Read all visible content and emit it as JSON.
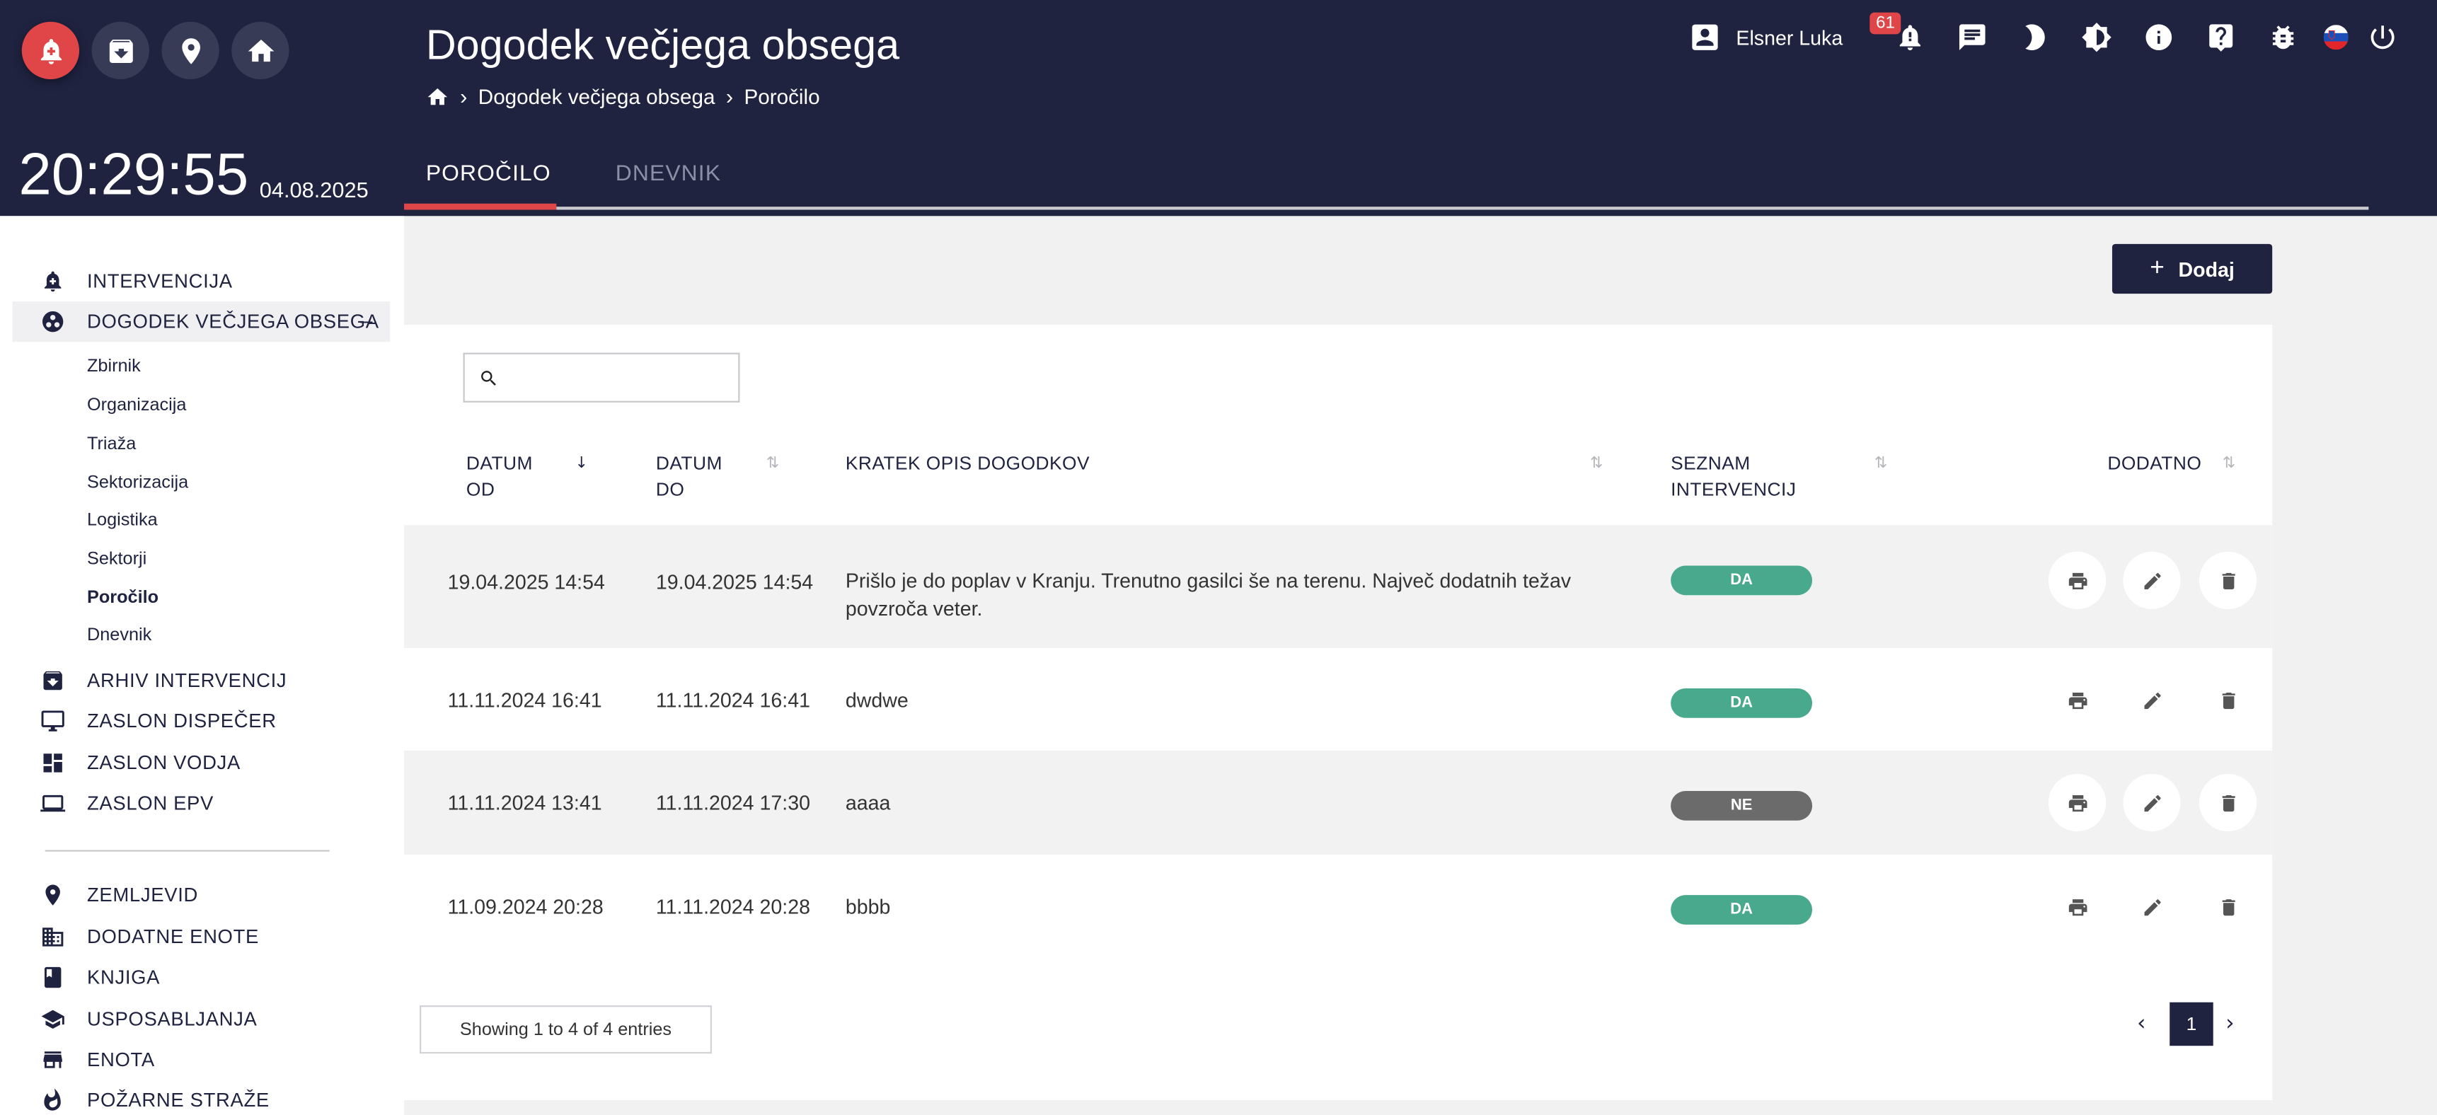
{
  "header": {
    "title": "Dogodek večjega obsega",
    "breadcrumb": [
      "Dogodek večjega obsega",
      "Poročilo"
    ],
    "time": "20:29:55",
    "date": "04.08.2025",
    "user_name": "Elsner Luka",
    "notification_count": "61",
    "tabs": [
      {
        "label": "POROČILO",
        "active": true
      },
      {
        "label": "DNEVNIK",
        "active": false
      }
    ],
    "icons": [
      "alarm-add-icon",
      "archive-icon",
      "location-pin-icon",
      "home-icon",
      "account-box-icon",
      "bell-icon",
      "chat-icon",
      "moon-icon",
      "brightness-icon",
      "info-icon",
      "help-icon",
      "bug-icon",
      "slovenia-flag-icon",
      "power-icon"
    ]
  },
  "sidebar": {
    "items_top": [
      {
        "label": "INTERVENCIJA",
        "icon": "alarm-add-icon"
      },
      {
        "label": "DOGODEK VEČJEGA OBSEGA",
        "icon": "incident-icon",
        "expanded": true,
        "collapse_symbol": "–"
      }
    ],
    "sub_items": [
      "Zbirnik",
      "Organizacija",
      "Triaža",
      "Sektorizacija",
      "Logistika",
      "Sektorji",
      "Poročilo",
      "Dnevnik"
    ],
    "items_mid": [
      {
        "label": "ARHIV INTERVENCIJ",
        "icon": "archive-icon"
      },
      {
        "label": "ZASLON DISPEČER",
        "icon": "monitor-icon"
      },
      {
        "label": "ZASLON VODJA",
        "icon": "dashboard-icon"
      },
      {
        "label": "ZASLON EPV",
        "icon": "laptop-icon"
      }
    ],
    "items_bottom": [
      {
        "label": "ZEMLJEVID",
        "icon": "location-pin-icon"
      },
      {
        "label": "DODATNE ENOTE",
        "icon": "building-icon"
      },
      {
        "label": "KNJIGA",
        "icon": "book-icon"
      },
      {
        "label": "USPOSABLJANJA",
        "icon": "school-icon"
      },
      {
        "label": "ENOTA",
        "icon": "store-icon"
      },
      {
        "label": "POŽARNE STRAŽE",
        "icon": "fire-icon"
      }
    ]
  },
  "toolbar": {
    "add_symbol": "+",
    "add_label": "Dodaj"
  },
  "search": {
    "placeholder": ""
  },
  "table": {
    "columns": [
      {
        "line1": "DATUM",
        "line2": "OD"
      },
      {
        "line1": "DATUM",
        "line2": "DO"
      },
      {
        "line1": "KRATEK OPIS DOGODKOV",
        "line2": ""
      },
      {
        "line1": "SEZNAM",
        "line2": "INTERVENCIJ"
      },
      {
        "line1": "DODATNO",
        "line2": ""
      }
    ],
    "rows": [
      {
        "from": "19.04.2025 14:54",
        "to": "19.04.2025 14:54",
        "desc": "Prišlo je do poplav v Kranju. Trenutno gasilci še na terenu. Največ dodatnih težav povzroča veter.",
        "status": "DA"
      },
      {
        "from": "11.11.2024 16:41",
        "to": "11.11.2024 16:41",
        "desc": "dwdwe",
        "status": "DA"
      },
      {
        "from": "11.11.2024 13:41",
        "to": "11.11.2024 17:30",
        "desc": "aaaa",
        "status": "NE"
      },
      {
        "from": "11.09.2024 20:28",
        "to": "11.11.2024 20:28",
        "desc": "bbbb",
        "status": "DA"
      }
    ],
    "actions": [
      "print-icon",
      "edit-icon",
      "delete-icon"
    ],
    "status_colors": {
      "DA": "#48a98d",
      "NE": "#6b6b6b"
    }
  },
  "footer": {
    "showing": "Showing 1 to 4 of 4 entries",
    "page": "1",
    "prev": "‹",
    "next": "›"
  },
  "colors": {
    "primary": "#1f2340",
    "accent": "#e04547"
  }
}
